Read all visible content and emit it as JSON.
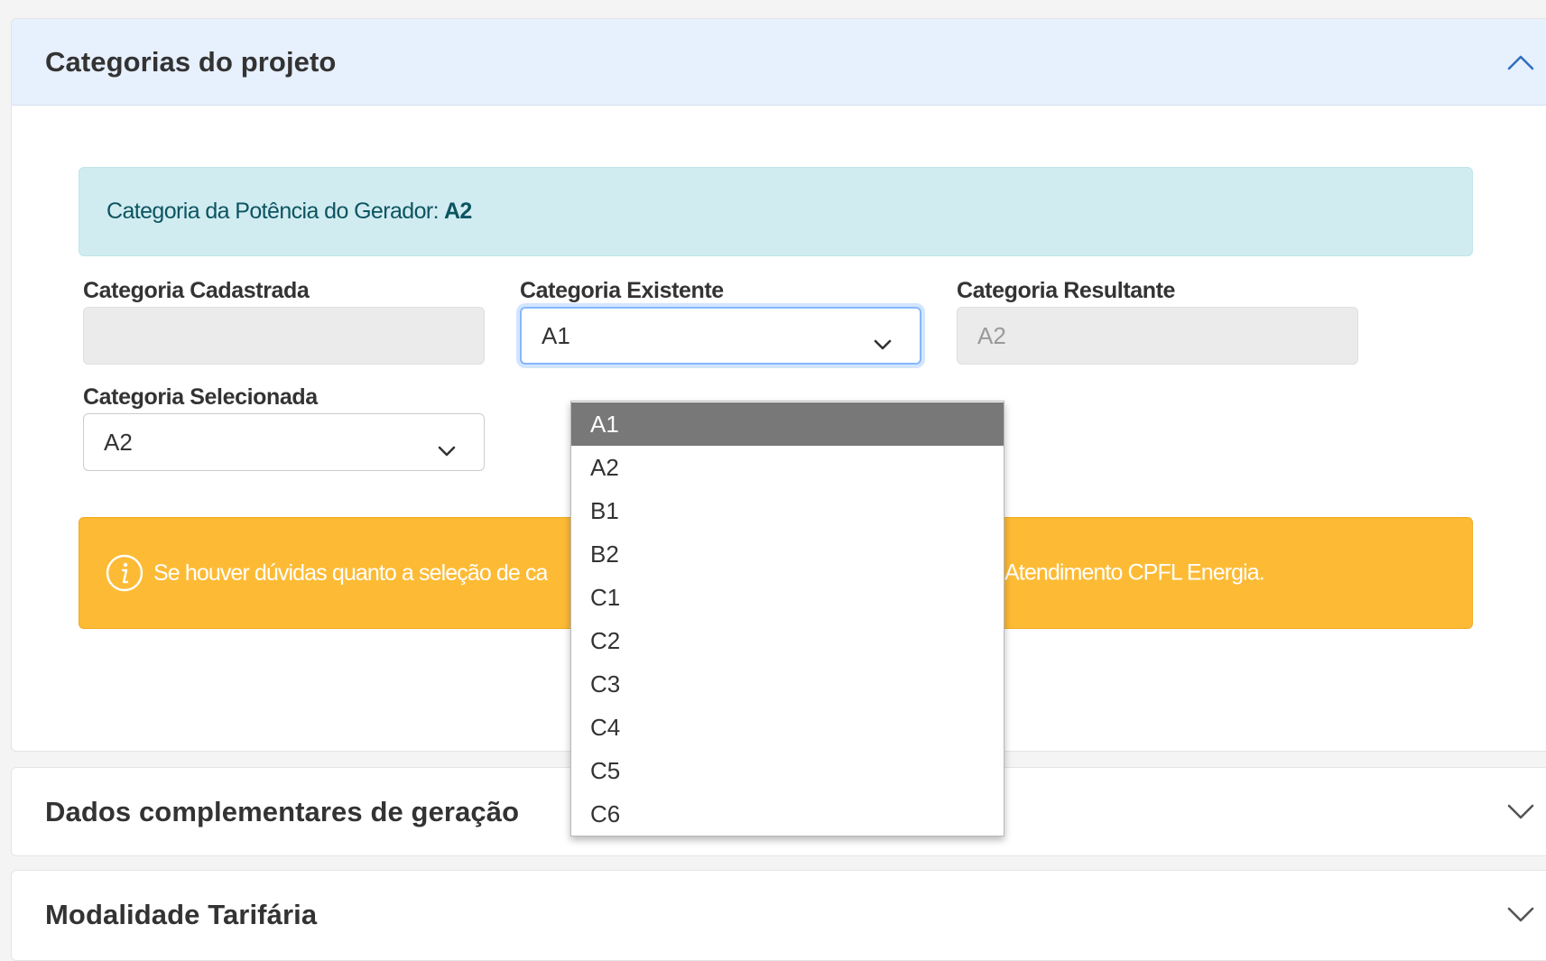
{
  "sections": [
    {
      "title": "Categorias do projeto",
      "expanded": true
    },
    {
      "title": "Dados complementares de geração",
      "expanded": false
    },
    {
      "title": "Modalidade Tarifária",
      "expanded": false
    }
  ],
  "info_banner": {
    "text": "Categoria da Potência do Gerador:",
    "value": "A2"
  },
  "fields": {
    "cadastrada": {
      "label": "Categoria Cadastrada",
      "value": ""
    },
    "existente": {
      "label": "Categoria Existente",
      "value": "A1"
    },
    "resultante": {
      "label": "Categoria Resultante",
      "value": "A2"
    },
    "selecionada": {
      "label": "Categoria Selecionada",
      "value": "A2"
    }
  },
  "warning": {
    "text_visible_start": "Se houver dúvidas quanto a seleção de ca",
    "text_visible_end": "Atendimento CPFL Energia."
  },
  "dropdown": {
    "options": [
      "A1",
      "A2",
      "B1",
      "B2",
      "C1",
      "C2",
      "C3",
      "C4",
      "C5",
      "C6"
    ],
    "highlighted": "A1"
  },
  "icons": {
    "expanded_chevron": "chevron-up-icon",
    "collapsed_chevron": "chevron-down-icon",
    "select_caret": "chevron-down-icon",
    "warning_icon": "info-circle-icon"
  },
  "colors": {
    "header_active_bg": "#e7f0fd",
    "info_bg": "#d1ecf1",
    "info_text": "#0c5460",
    "warning_bg": "#fdbb35",
    "highlight_bg": "#787878",
    "focus_border": "#86b7fe"
  }
}
